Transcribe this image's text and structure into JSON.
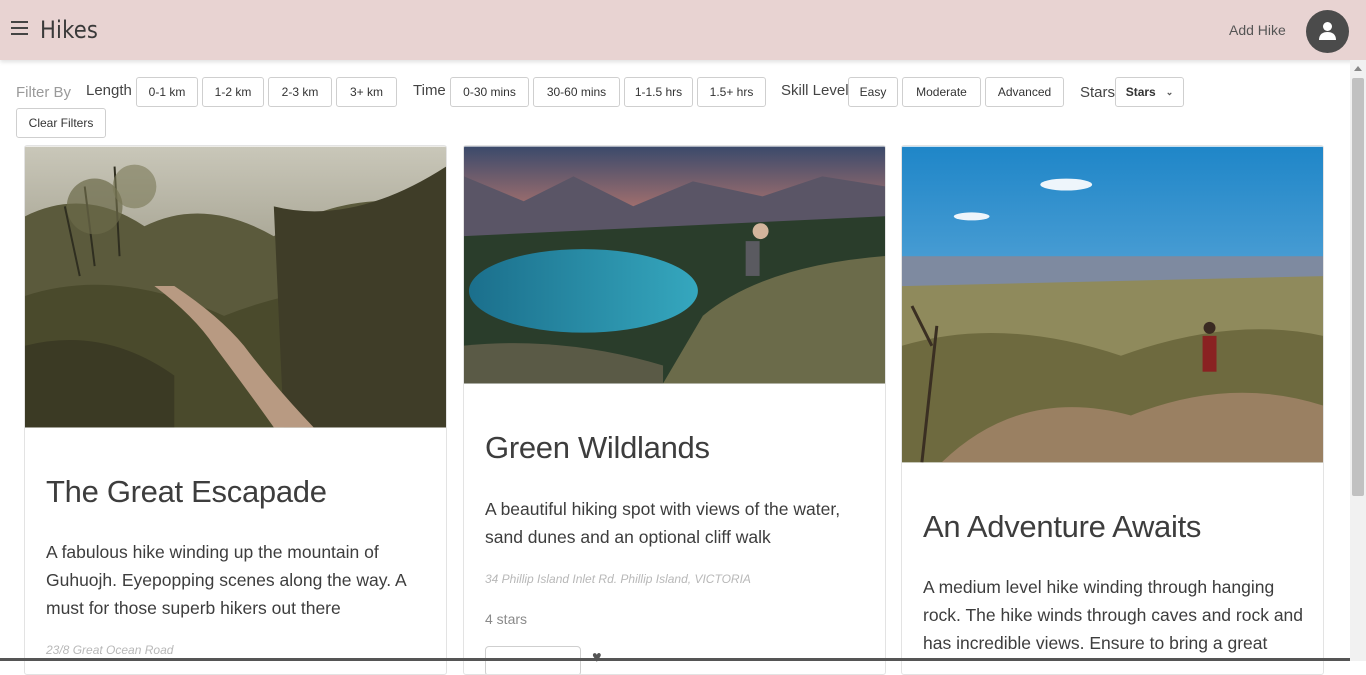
{
  "app": {
    "title": "Hikes",
    "add_hike": "Add Hike"
  },
  "filters": {
    "filter_by": "Filter By",
    "length_label": "Length",
    "length_options": [
      "0-1 km",
      "1-2 km",
      "2-3 km",
      "3+ km"
    ],
    "time_label": "Time",
    "time_options": [
      "0-30 mins",
      "30-60 mins",
      "1-1.5 hrs",
      "1.5+ hrs"
    ],
    "skill_label": "Skill Level",
    "skill_options": [
      "Easy",
      "Moderate",
      "Advanced"
    ],
    "stars_label": "Stars",
    "stars_select": "Stars",
    "clear": "Clear Filters"
  },
  "hikes": [
    {
      "title": "The Great Escapade",
      "description": "A fabulous hike winding up the mountain of Guhuojh. Eyepopping scenes along the way. A must for those superb hikers out there",
      "address": "23/8 Great Ocean Road"
    },
    {
      "title": "Green Wildlands",
      "description": "A beautiful hiking spot with views of the water, sand dunes and an optional cliff walk",
      "address": "34 Phillip Island Inlet Rd. Phillip Island, VICTORIA",
      "stars": "4 stars"
    },
    {
      "title": "An Adventure Awaits",
      "description": "A medium level hike winding through hanging rock. The hike winds through caves and rock and has incredible views. Ensure to bring a great"
    }
  ]
}
